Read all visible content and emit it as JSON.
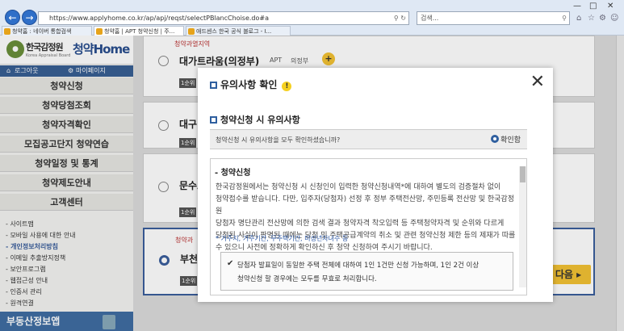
{
  "browser": {
    "url": "https://www.applyhome.co.kr/ap/apj/reqst/selectPBlancChoise.do#a",
    "search_placeholder": "검색...",
    "tabs": [
      "청약홈 : 네이버 통합검색",
      "청약홈 | APT 청약신청 | 주...",
      "애드센스 한국 공식 블로그 - I..."
    ]
  },
  "sidebar": {
    "logo_korean": "한국감정원",
    "logo_english": "Korea Appraisal Board",
    "logo_service": "청약Home",
    "logout_label": "로그아웃",
    "mypage_label": "마이페이지",
    "menu": [
      "청약신청",
      "청약당첨조회",
      "청약자격확인",
      "모집공고단지 청약연습",
      "청약일정 및 통계",
      "청약제도안내",
      "고객센터"
    ],
    "submenu": [
      "사이트맵",
      "모바일 사용에 대한 안내",
      "개인정보처리방침",
      "이메일 추출방지정책",
      "보안프로그램",
      "웹접근성 안내",
      "인증서 관리",
      "원격연결"
    ],
    "banner": "부동산정보앱"
  },
  "main": {
    "region_label": "청약과열지역",
    "region_label_2": "청약과",
    "listings": [
      {
        "name": "대가트라움(의정부)",
        "type": "APT",
        "area": "의정부",
        "rank": "1순위"
      },
      {
        "name": "대구",
        "rank": "1순위"
      },
      {
        "name": "문수로",
        "rank": "1순위"
      },
      {
        "name": "부천",
        "rank": "1순위"
      }
    ],
    "next_label": "다음"
  },
  "modal": {
    "title": "유의사항 확인",
    "section": "청약신청 시 유의사항",
    "question": "청약신청 시 유의사항을 모두 확인하셨습니까?",
    "confirm_label": "확인함",
    "subsection": "청약신청",
    "body_lines": [
      "한국감정원에서는 청약신청 시 신청인이 입력한 청약신청내역*에 대하여 별도의 검증절차 없이",
      "청약접수를 받습니다. 다만, 입주자(당첨자) 선정 후 정부 주택전산망, 주민등록 전산망 및 한국감정원",
      "당첨자 명단관리 전산망에 의한 검색 결과 청약자격 착오입력 등 주택청약자격 및 순위와 다르게",
      "당첨된 사실이 판명된 때에는 당첨 및 주택공급계약의 취소 및 관련 청약신청 제한 등의 제재가 따를",
      "수 있으니 사전에 정확하게 확인하신 후 청약 신청하여 주시기 바랍니다."
    ],
    "note": "* 거주지, 거주기간, 무주택기간, 미성년자녀수 등",
    "check_line1": "당첨자 발표일이 동일한 주택 전체에 대하여 1인 1건만 신청 가능하며, 1인 2건 이상",
    "check_line2": "청약신청 할 경우에는 모두를 무효로 처리합니다."
  }
}
